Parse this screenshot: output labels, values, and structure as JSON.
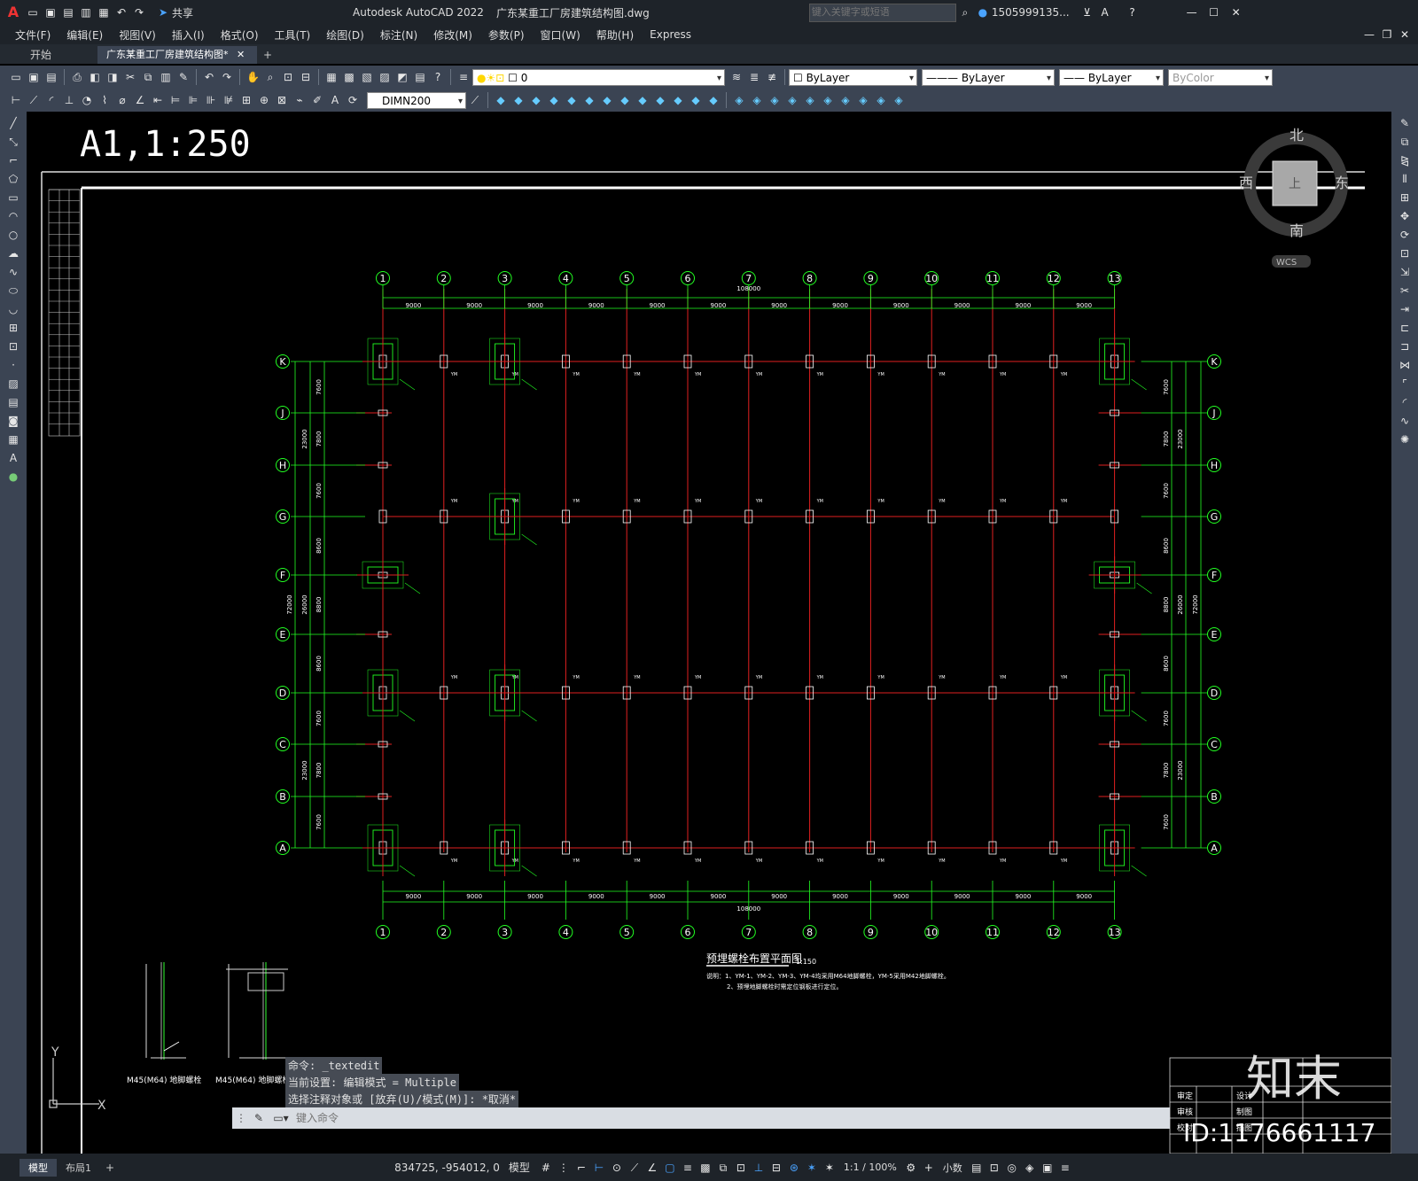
{
  "title": {
    "app": "Autodesk AutoCAD 2022",
    "file": "广东某重工厂房建筑结构图.dwg",
    "search_placeholder": "键入关键字或短语",
    "user": "1505999135...",
    "share": "共享"
  },
  "menus": [
    "文件(F)",
    "编辑(E)",
    "视图(V)",
    "插入(I)",
    "格式(O)",
    "工具(T)",
    "绘图(D)",
    "标注(N)",
    "修改(M)",
    "参数(P)",
    "窗口(W)",
    "帮助(H)",
    "Express"
  ],
  "tabs": {
    "start": "开始",
    "doc": "广东某重工厂房建筑结构图*",
    "add": "+"
  },
  "toolbar": {
    "layer": "0",
    "color": "ByLayer",
    "linetype": "ByLayer",
    "lineweight": "ByLayer",
    "plotstyle": "ByColor",
    "dimstyle": "DIMN200"
  },
  "viewcube": {
    "north": "北",
    "south": "南",
    "east": "东",
    "west": "西",
    "top": "上",
    "wcs": "WCS"
  },
  "drawing": {
    "scale_text": "A1,1:250",
    "columns": [
      "1",
      "2",
      "3",
      "4",
      "5",
      "6",
      "7",
      "8",
      "9",
      "10",
      "11",
      "12",
      "13"
    ],
    "rows": [
      "K",
      "J",
      "H",
      "G",
      "F",
      "E",
      "D",
      "C",
      "B",
      "A"
    ],
    "bay": "9000",
    "total_x": "108000",
    "left_dims": [
      "7600",
      "7800",
      "7600",
      "8600",
      "8800",
      "8600",
      "7600",
      "7800",
      "7600"
    ],
    "group_dims": [
      "23000",
      "26000",
      "23000"
    ],
    "total_y": "72000",
    "plan_title": "预埋螺栓布置平面图",
    "plan_scale": "1:150",
    "note1": "说明：1、YM-1、YM-2、YM-3、YM-4均采用M64地脚螺栓，YM-5采用M42地脚螺栓。",
    "note2": "2、预埋地脚螺栓时需定位钢板进行定位。",
    "detail1": "M45(M64) 地脚螺栓",
    "detail2": "M45(M64) 地脚螺栓",
    "id_text": "ID:1176661117",
    "logo": "知末",
    "titleblock": [
      "审定",
      "设计",
      "审核",
      "制图",
      "校对",
      "描图"
    ]
  },
  "command": {
    "line1": "命令: _textedit",
    "line2": "当前设置: 编辑模式 = Multiple",
    "line3": "选择注释对象或 [放弃(U)/模式(M)]: *取消*",
    "placeholder": "键入命令"
  },
  "layouts": {
    "model": "模型",
    "layout1": "布局1",
    "add": "+"
  },
  "status": {
    "coords": "834725, -954012, 0",
    "space": "模型",
    "annoscale": "1:1 / 100%",
    "units": "小数"
  }
}
